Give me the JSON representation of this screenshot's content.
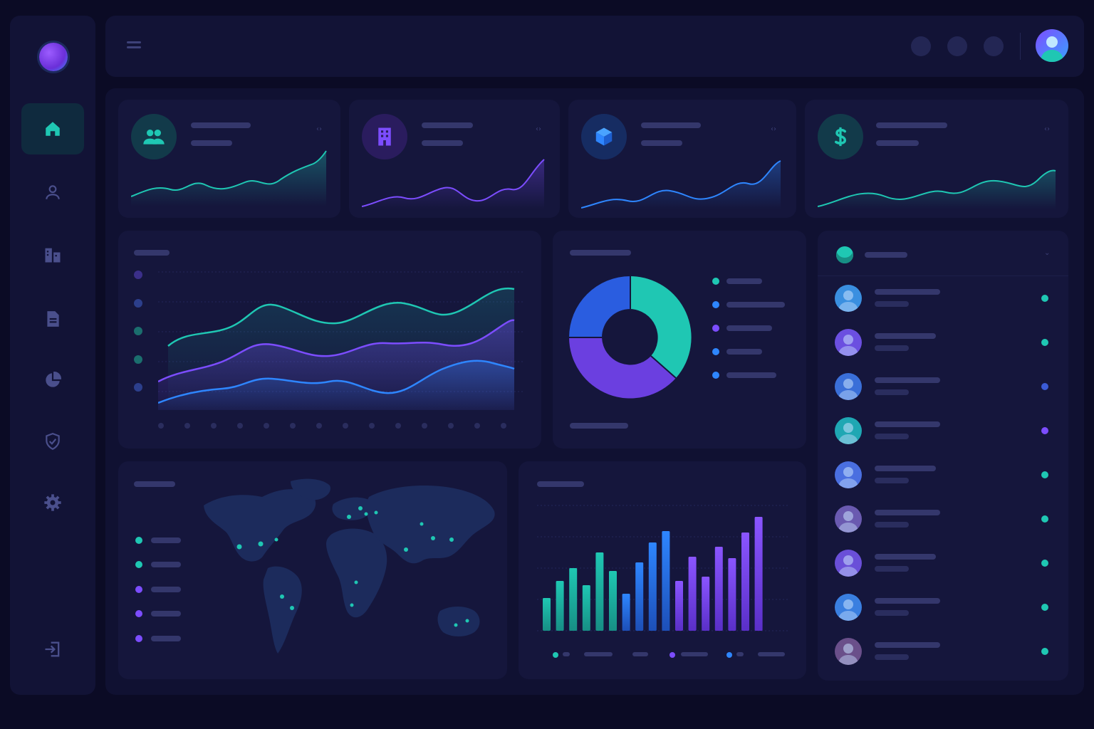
{
  "sidebar": {
    "items": [
      {
        "id": "home",
        "icon": "home-icon",
        "active": true
      },
      {
        "id": "users",
        "icon": "user-icon",
        "active": false
      },
      {
        "id": "buildings",
        "icon": "building-icon",
        "active": false
      },
      {
        "id": "documents",
        "icon": "document-icon",
        "active": false
      },
      {
        "id": "reports",
        "icon": "pie-chart-icon",
        "active": false
      },
      {
        "id": "security",
        "icon": "shield-icon",
        "active": false
      },
      {
        "id": "settings",
        "icon": "gear-icon",
        "active": false
      }
    ],
    "logout_icon": "logout-icon"
  },
  "stat_cards": [
    {
      "icon": "users-icon",
      "color": "#1fc7b3"
    },
    {
      "icon": "building-icon",
      "color": "#7c4dff"
    },
    {
      "icon": "cube-icon",
      "color": "#2e86ff"
    },
    {
      "icon": "dollar-icon",
      "color": "#1fc7b3"
    }
  ],
  "donut": {
    "slices": [
      {
        "color": "#1fc7b3",
        "fraction": 0.36
      },
      {
        "color": "#6b3fe0",
        "fraction": 0.34
      },
      {
        "color": "#2a5de0",
        "fraction": 0.3
      }
    ],
    "legend_colors": [
      "#1fc7b3",
      "#2e86ff",
      "#7c4dff",
      "#2e86ff",
      "#2e86ff"
    ]
  },
  "map": {
    "legend_colors": [
      "#1fc7b3",
      "#1fc7b3",
      "#7c4dff",
      "#7c4dff",
      "#7c4dff"
    ]
  },
  "activity_list": {
    "status_colors": [
      "#1fc7b3",
      "#1fc7b3",
      "#3b5bd6",
      "#7c4dff",
      "#1fc7b3",
      "#1fc7b3",
      "#1fc7b3",
      "#1fc7b3",
      "#1fc7b3"
    ]
  },
  "colors": {
    "accent_teal": "#1fc7b3",
    "accent_purple": "#7c4dff",
    "accent_blue": "#2e86ff",
    "background": "#0b0b25"
  }
}
